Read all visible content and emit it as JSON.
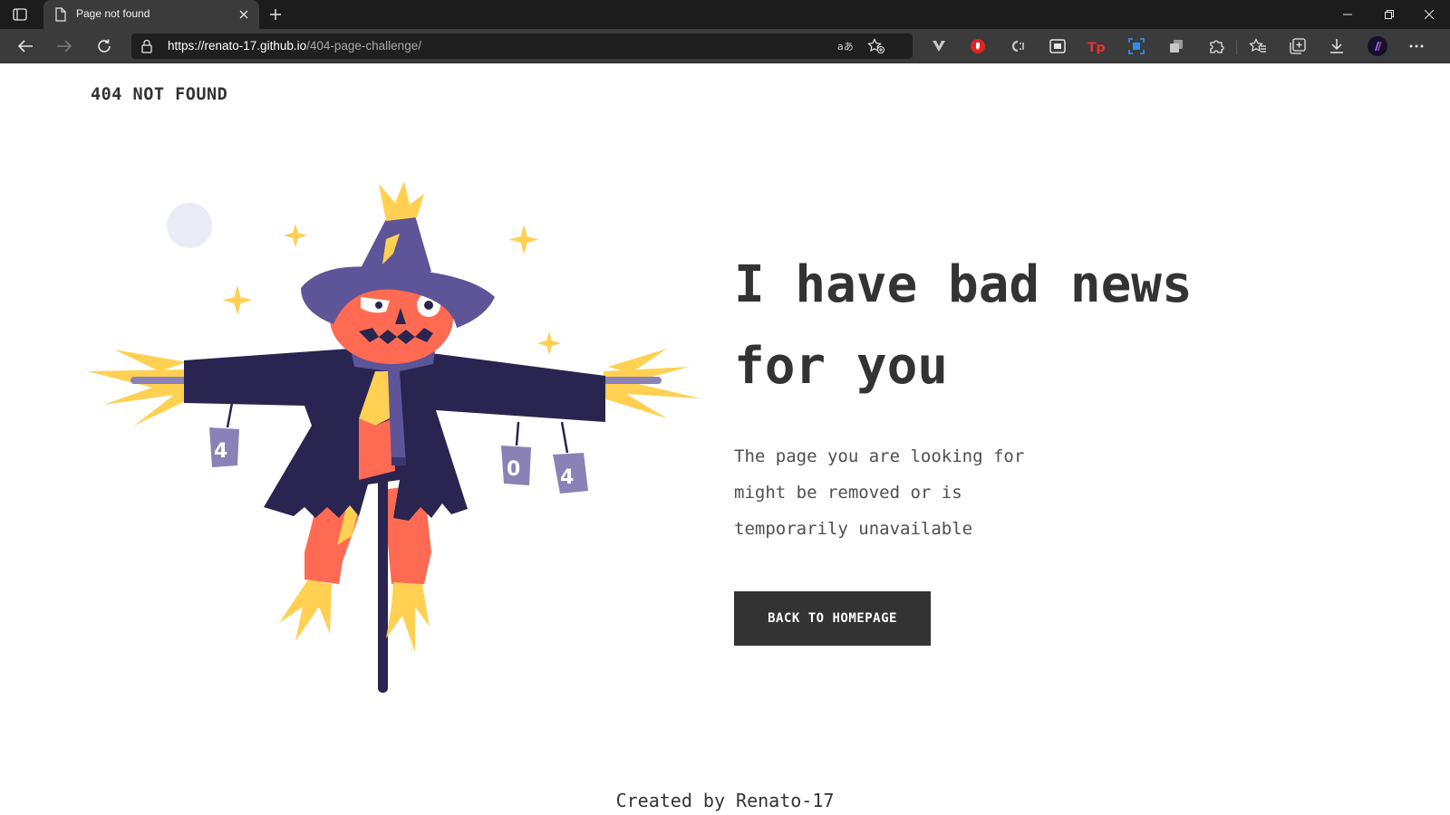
{
  "browser": {
    "tab": {
      "title": "Page not found"
    },
    "address": {
      "host": "https://renato-17.github.io",
      "path": "/404-page-challenge/"
    }
  },
  "page": {
    "brand": "404 NOT FOUND",
    "headline_line1": "I have bad news",
    "headline_line2": "for you",
    "message": "The page you are looking for might be removed or is temporarily unavailable",
    "button_label": "BACK TO HOMEPAGE",
    "footer": "Created by Renato-17",
    "cans": [
      "4",
      "0",
      "4"
    ]
  },
  "colors": {
    "text_dark": "#333333",
    "button_bg": "#333333",
    "scarecrow_coat": "#2a2451",
    "scarecrow_hat": "#5e5498",
    "scarecrow_face": "#ff6b52",
    "straw": "#ffd052",
    "can": "#8a82b6",
    "moon": "#e9ecf7"
  }
}
